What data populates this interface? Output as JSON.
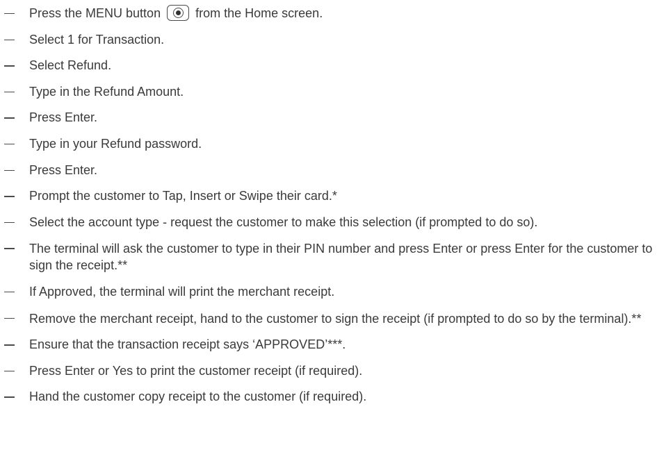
{
  "steps": [
    {
      "before": "Press the MENU button",
      "after": "from the Home screen."
    },
    "Select 1 for Transaction.",
    "Select Refund.",
    "Type in the Refund Amount.",
    "Press Enter.",
    "Type in your Refund password.",
    "Press Enter.",
    "Prompt the customer to Tap, Insert or Swipe their card.*",
    "Select the account type - request the customer to make this selection (if prompted to do so).",
    "The terminal will ask the customer to type in their PIN number and press Enter or press Enter for the customer to sign the receipt.**",
    "If Approved, the terminal will print the merchant receipt.",
    "Remove the merchant receipt, hand to the customer to sign the receipt (if prompted to do so by the terminal).**",
    "Ensure that the transaction receipt says ‘APPROVED’***.",
    "Press Enter or Yes to print the customer receipt (if required).",
    "Hand the customer copy receipt to the customer (if required)."
  ],
  "icons": {
    "menu_button": "menu-button-icon"
  }
}
